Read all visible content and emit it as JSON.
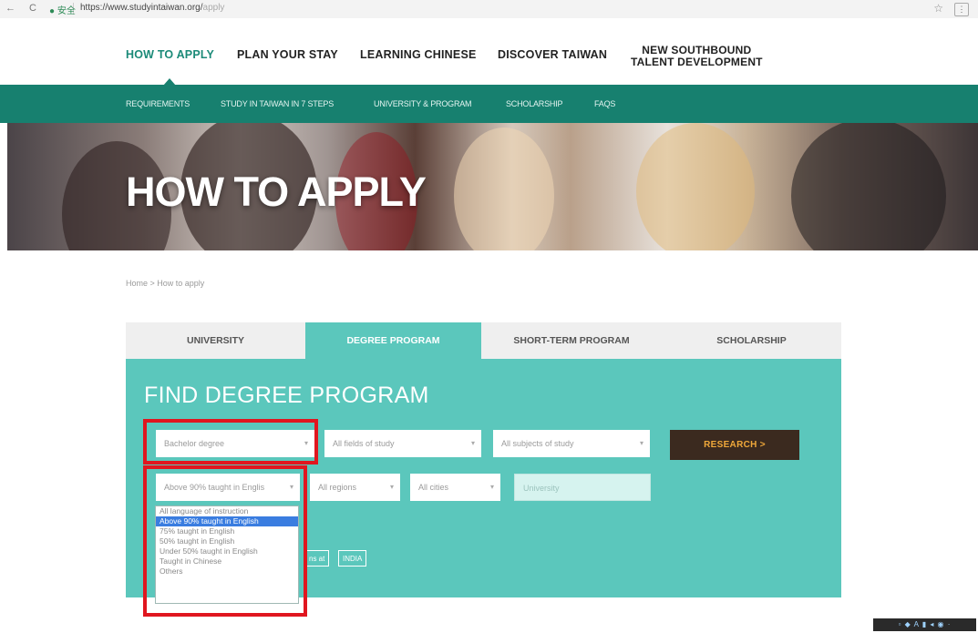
{
  "browser": {
    "nav_icons": "← C",
    "secure_label": "● 安全",
    "url_domain": "https://www.studyintaiwan.org/",
    "url_path": "apply",
    "star_icon": "☆",
    "ext_icon": "⋮"
  },
  "topnav": {
    "items": [
      {
        "label": "HOW TO APPLY",
        "active": true
      },
      {
        "label": "PLAN YOUR STAY"
      },
      {
        "label": "LEARNING CHINESE"
      },
      {
        "label": "DISCOVER TAIWAN"
      },
      {
        "label_line1": "NEW SOUTHBOUND",
        "label_line2": "TALENT DEVELOPMENT"
      }
    ]
  },
  "subnav": {
    "items": [
      {
        "label": "REQUIREMENTS"
      },
      {
        "label": "STUDY IN TAIWAN IN 7 STEPS"
      },
      {
        "label": "UNIVERSITY & PROGRAM"
      },
      {
        "label": "SCHOLARSHIP"
      },
      {
        "label": "FAQS"
      }
    ]
  },
  "hero": {
    "title": "HOW TO APPLY"
  },
  "breadcrumb": {
    "text": "Home  >  How to apply"
  },
  "tabs": [
    {
      "label": "UNIVERSITY"
    },
    {
      "label": "DEGREE PROGRAM",
      "active": true
    },
    {
      "label": "SHORT-TERM PROGRAM"
    },
    {
      "label": "SCHOLARSHIP"
    }
  ],
  "search": {
    "heading": "FIND DEGREE PROGRAM",
    "degree_select": "Bachelor degree",
    "fields_select": "All fields of study",
    "subjects_select": "All subjects of study",
    "research_button": "RESEARCH  >",
    "language_select": "Above 90% taught in Englis",
    "regions_select": "All regions",
    "cities_select": "All cities",
    "university_placeholder": "University",
    "mini_tag_1": "ns at",
    "mini_tag_2": "INDIA",
    "arrow_glyph": "▾"
  },
  "language_dropdown": {
    "options": [
      {
        "label": "All language of instruction"
      },
      {
        "label": "Above 90% taught in English",
        "selected": true
      },
      {
        "label": "75% taught in English"
      },
      {
        "label": "50% taught in English"
      },
      {
        "label": "Under 50% taught in English"
      },
      {
        "label": "Taught in Chinese"
      },
      {
        "label": "Others"
      }
    ]
  },
  "colors": {
    "brand_teal_dark": "#17806f",
    "panel_teal": "#5bc7bc",
    "highlight_red": "#e0161f",
    "button_dark": "#3b2a1f",
    "button_text": "#f0a83a"
  },
  "taskbar": {
    "tray_text": "▫ ◆ A ▮ ◂ ◉ ·"
  }
}
